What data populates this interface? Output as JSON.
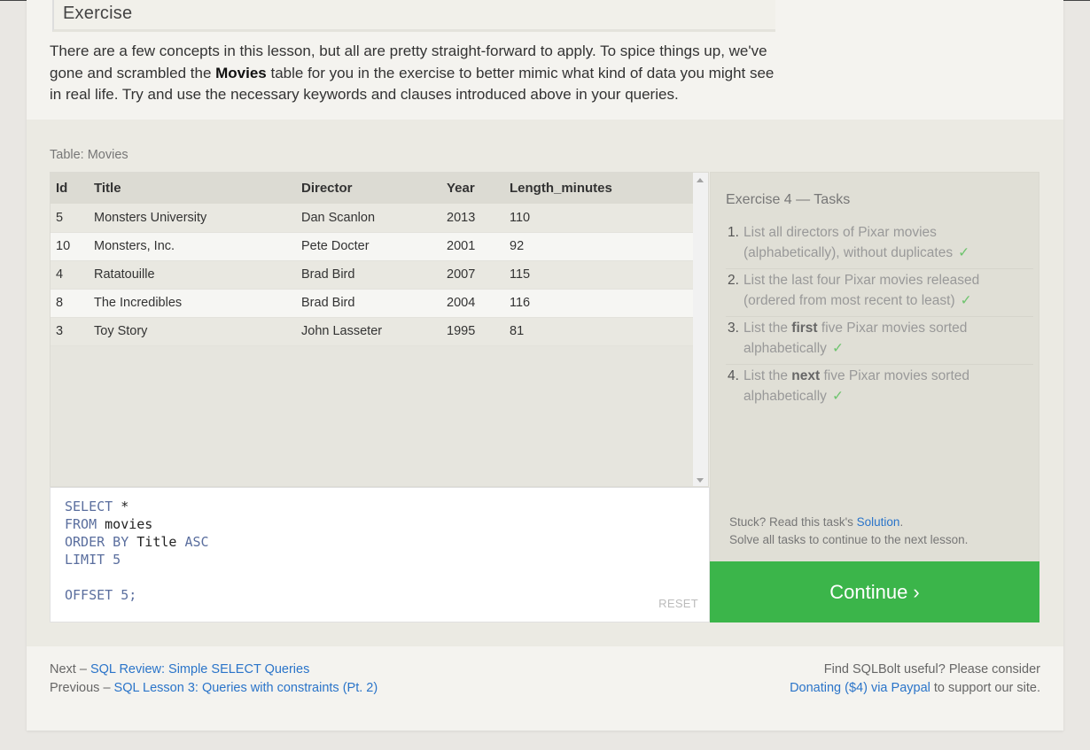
{
  "section": {
    "heading": "Exercise",
    "intro_part1": "There are a few concepts in this lesson, but all are pretty straight-forward to apply. To spice things up, we've gone and scrambled the ",
    "intro_bold": "Movies",
    "intro_part2": " table for you in the exercise to better mimic what kind of data you might see in real life. Try and use the necessary keywords and clauses introduced above in your queries."
  },
  "table": {
    "caption": "Table: Movies",
    "columns": [
      "Id",
      "Title",
      "Director",
      "Year",
      "Length_minutes"
    ],
    "rows": [
      [
        "5",
        "Monsters University",
        "Dan Scanlon",
        "2013",
        "110"
      ],
      [
        "10",
        "Monsters, Inc.",
        "Pete Docter",
        "2001",
        "92"
      ],
      [
        "4",
        "Ratatouille",
        "Brad Bird",
        "2007",
        "115"
      ],
      [
        "8",
        "The Incredibles",
        "Brad Bird",
        "2004",
        "116"
      ],
      [
        "3",
        "Toy Story",
        "John Lasseter",
        "1995",
        "81"
      ]
    ]
  },
  "editor": {
    "line1_kw": "SELECT",
    "line1_rest": " *",
    "line2_kw": "FROM",
    "line2_rest": " movies",
    "line3_kw": "ORDER BY",
    "line3_mid": " Title ",
    "line3_kw2": "ASC",
    "line4_kw": "LIMIT",
    "line4_rest": " 5",
    "line6_kw": "OFFSET",
    "line6_rest": " 5;",
    "reset_label": "RESET"
  },
  "tasks": {
    "title": "Exercise 4 — Tasks",
    "items": [
      {
        "num": "1.",
        "pre": "List all directors of Pixar movies (alphabetically), without duplicates",
        "bold": "",
        "post": "",
        "check": "✓"
      },
      {
        "num": "2.",
        "pre": "List the last four Pixar movies released (ordered from most recent to least)",
        "bold": "",
        "post": "",
        "check": "✓"
      },
      {
        "num": "3.",
        "pre": "List the ",
        "bold": "first",
        "post": " five Pixar movies sorted alphabetically",
        "check": "✓"
      },
      {
        "num": "4.",
        "pre": "List the ",
        "bold": "next",
        "post": " five Pixar movies sorted alphabetically",
        "check": "✓"
      }
    ],
    "stuck_prefix": "Stuck? Read this task's ",
    "solution_link": "Solution",
    "stuck_suffix": ".",
    "solve_all": "Solve all tasks to continue to the next lesson.",
    "continue_label": "Continue ›"
  },
  "footer": {
    "next_prefix": "Next – ",
    "next_link": "SQL Review: Simple SELECT Queries",
    "prev_prefix": "Previous – ",
    "prev_link": "SQL Lesson 3: Queries with constraints (Pt. 2)",
    "useful_text": "Find SQLBolt useful? Please consider",
    "donate_link": "Donating ($4) via Paypal",
    "donate_suffix": " to support our site."
  },
  "colors": {
    "continue_button": "#3bb54a",
    "link": "#2a74c9",
    "sql_keyword": "#5a6e9e",
    "check": "#6fc46f"
  }
}
